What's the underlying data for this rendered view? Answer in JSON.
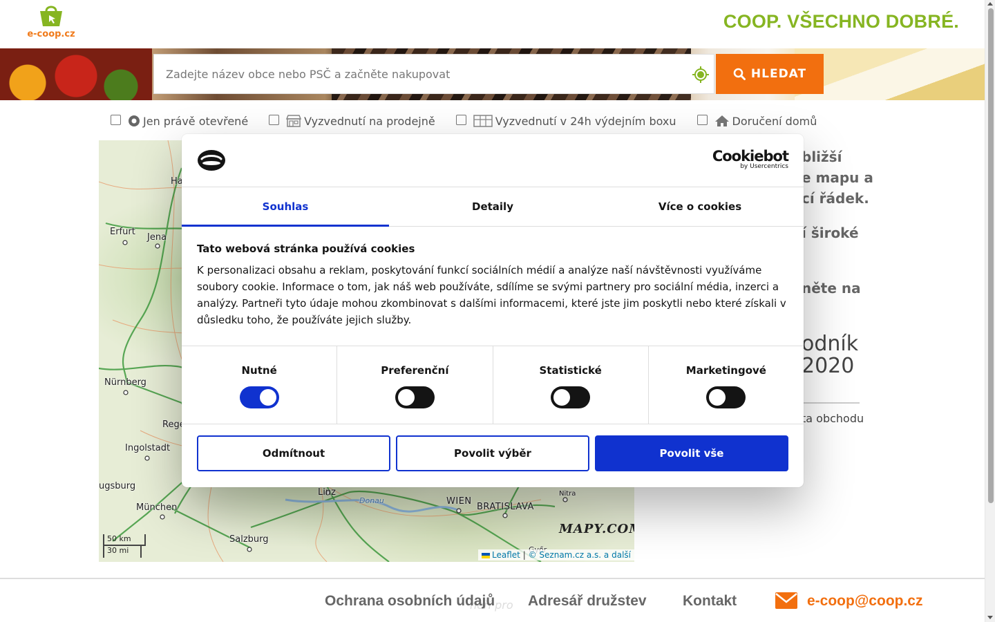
{
  "header": {
    "logo_text": "e-coop.cz",
    "slogan": "COOP. VŠECHNO DOBRÉ."
  },
  "search": {
    "placeholder": "Zadejte název obce nebo PSČ a začněte nakupovat",
    "button_label": "HLEDAT"
  },
  "filters": [
    {
      "label": "Jen právě otevřené",
      "icon": "clock-icon",
      "checked": false
    },
    {
      "label": "Vyzvednutí na prodejně",
      "icon": "store-icon",
      "checked": false
    },
    {
      "label": "Vyzvednutí v 24h výdejním boxu",
      "icon": "locker-icon",
      "checked": false
    },
    {
      "label": "Doručení domů",
      "icon": "home-icon",
      "checked": false
    }
  ],
  "map": {
    "cities": [
      "Erfurt",
      "Jena",
      "Ha",
      "Nürnberg",
      "Rege",
      "Ingolstadt",
      "ugsburg",
      "München",
      "Salzburg",
      "Linz",
      "WIEN",
      "BRATISLAVA",
      "Nitra",
      "Donau",
      "Győr"
    ],
    "scale_km": "50 km",
    "scale_mi": "30 mi",
    "provider_logo": "MAPY.COM",
    "attribution_leaflet": "Leaflet",
    "attribution_sep": "|",
    "attribution_source": "© Seznam.cz a.s. a další"
  },
  "side_text": {
    "lines": [
      "bližší",
      "e mapu a",
      "cí řádek.",
      "í široké",
      "něte na"
    ],
    "award_line1": "odník",
    "award_line2": "2020",
    "award_sub": "ta obchodu"
  },
  "footer": {
    "privacy": "Ochrana osobních údajů",
    "directory": "Adresář družstev",
    "contact": "Kontakt",
    "email": "e-coop@coop.cz",
    "ghost_text": "neří pro"
  },
  "cookie_dialog": {
    "brand": "Cookiebot",
    "brand_by": "by Usercentrics",
    "tabs": [
      "Souhlas",
      "Detaily",
      "Více o cookies"
    ],
    "active_tab": "Souhlas",
    "title": "Tato webová stránka používá cookies",
    "text": "K personalizaci obsahu a reklam, poskytování funkcí sociálních médií a analýze naší návštěvnosti využíváme soubory cookie. Informace o tom, jak náš web používáte, sdílíme se svými partnery pro sociální média, inzerci a analýzy. Partneři tyto údaje mohou zkombinovat s dalšími informacemi, které jste jim poskytli nebo které získali v důsledku toho, že používáte jejich služby.",
    "categories": [
      {
        "label": "Nutné",
        "enabled": true
      },
      {
        "label": "Preferenční",
        "enabled": false
      },
      {
        "label": "Statistické",
        "enabled": false
      },
      {
        "label": "Marketingové",
        "enabled": false
      }
    ],
    "buttons": {
      "deny": "Odmítnout",
      "allow_selection": "Povolit výběr",
      "allow_all": "Povolit vše"
    }
  },
  "colors": {
    "brand_green": "#86b522",
    "brand_orange": "#f26f0f",
    "cookiebot_blue": "#1032cf"
  }
}
